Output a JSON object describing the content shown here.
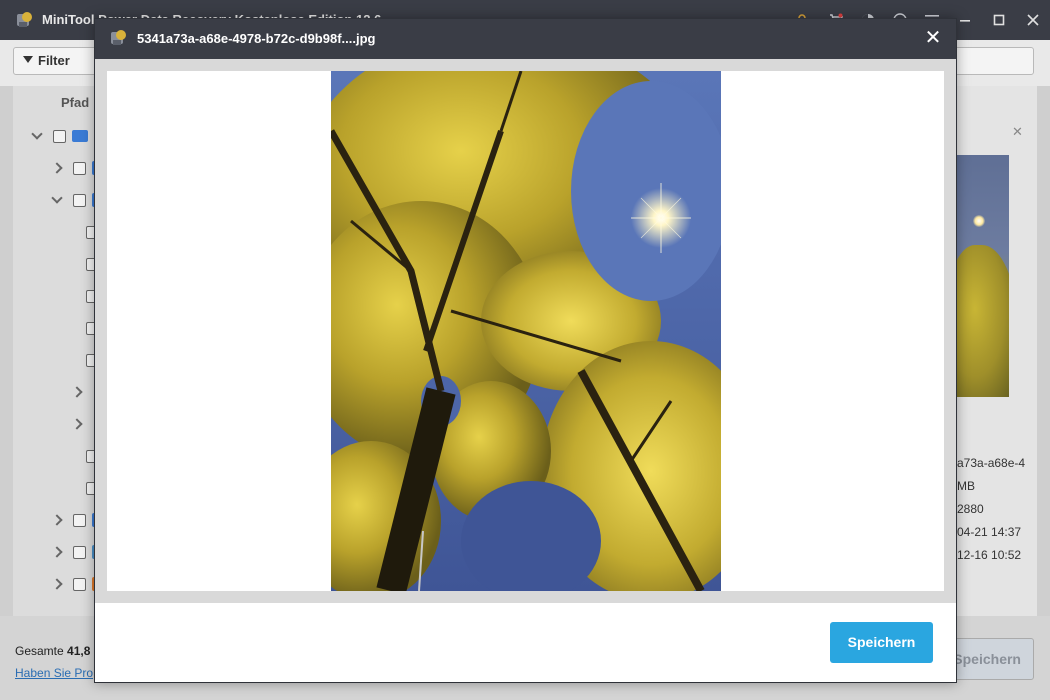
{
  "app": {
    "title": "MiniTool Power Data Recovery Kostenlose Edition 12.6"
  },
  "toolbar": {
    "filter_label": "Filter"
  },
  "tree": {
    "column_header": "Pfad"
  },
  "details": {
    "name_fragment": "a73a-a68e-4",
    "size_fragment": "MB",
    "dimension_fragment": "2880",
    "created_fragment": "04-21 14:37",
    "modified_fragment": "12-16 10:52"
  },
  "footer": {
    "total_label": "Gesamte",
    "total_value": "41,8",
    "help_link": "Haben Sie Pro",
    "save_label": "Speichern"
  },
  "preview": {
    "title": "5341a73a-a68e-4978-b72c-d9b98f....jpg",
    "close_glyph": "✕",
    "save_label": "Speichern"
  },
  "colors": {
    "accent": "#2aa6e0",
    "titlebar": "#3a3d46"
  },
  "icons": [
    "app-logo-icon",
    "filter-icon",
    "key-icon",
    "cart-icon",
    "theme-icon",
    "help-icon",
    "menu-icon",
    "minimize-icon",
    "maximize-icon",
    "close-icon"
  ]
}
